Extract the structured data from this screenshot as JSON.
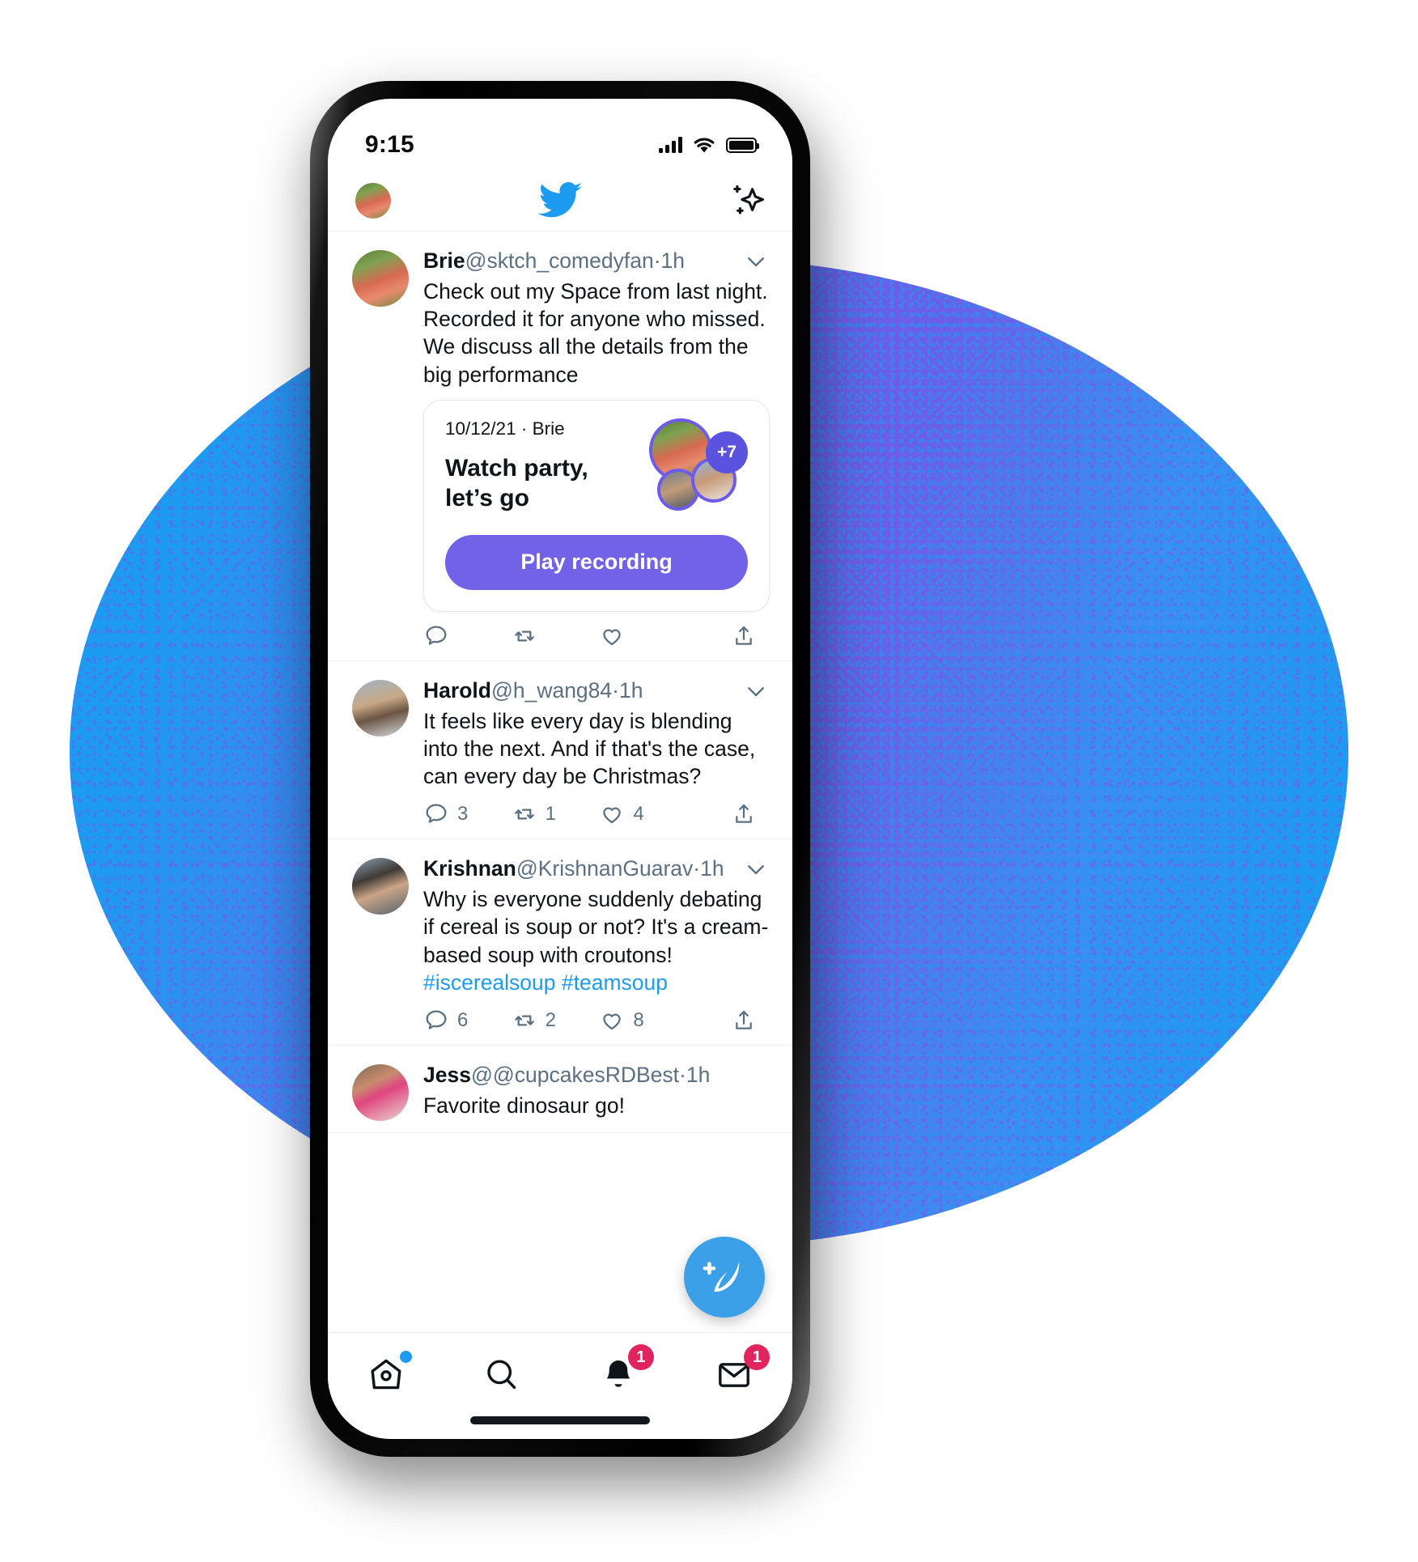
{
  "status_bar": {
    "time": "9:15",
    "icons": [
      "signal-bars-icon",
      "wifi-icon",
      "battery-icon"
    ]
  },
  "app_header": {
    "avatar_name": "brie-avatar",
    "logo": "twitter-bird-logo",
    "sparkle_label": "sparkle-icon"
  },
  "colors": {
    "twitter_blue": "#1d9bf0",
    "spaces_purple": "#7162e8",
    "badge_pink": "#e0245e",
    "text_primary": "#0f1419",
    "text_secondary": "#5b7083"
  },
  "tweets": [
    {
      "name": "Brie",
      "handle": "@sktch_comedyfan",
      "separator": "·",
      "time": "1h",
      "text": "Check out my Space from last night. Recorded it for anyone who missed. We discuss all the details from the big performance",
      "card": {
        "meta": "10/12/21 · Brie",
        "title_line1": "Watch party,",
        "title_line2": "let’s go",
        "extra_count": "+7",
        "button_label": "Play recording"
      },
      "actions": {
        "reply": "",
        "retweet": "",
        "like": "",
        "share": ""
      }
    },
    {
      "name": "Harold",
      "handle": "@h_wang84",
      "separator": "·",
      "time": "1h",
      "text": "It feels like every day is blending into the next. And if that's the case, can every day be Christmas?",
      "actions": {
        "reply": "3",
        "retweet": "1",
        "like": "4",
        "share": ""
      }
    },
    {
      "name": "Krishnan",
      "handle": "@KrishnanGuarav",
      "separator": "·",
      "time": "1h",
      "text_plain": "Why is everyone suddenly debating if cereal is soup or not? It's a cream-based soup with croutons! ",
      "hashtag1": "#iscerealsoup",
      "hashtag2": "#teamsoup",
      "actions": {
        "reply": "6",
        "retweet": "2",
        "like": "8",
        "share": ""
      }
    },
    {
      "name": "Jess",
      "handle": "@@cupcakesRDBest",
      "separator": "·",
      "time": "1h",
      "text": "Favorite dinosaur go!"
    }
  ],
  "compose": {
    "label": "compose-tweet-button"
  },
  "tab_bar": {
    "tabs": [
      {
        "name": "home-tab",
        "icon": "home-icon",
        "badge": "",
        "dot": true
      },
      {
        "name": "search-tab",
        "icon": "search-icon",
        "badge": "",
        "dot": false
      },
      {
        "name": "notifications-tab",
        "icon": "bell-icon",
        "badge": "1",
        "dot": false
      },
      {
        "name": "messages-tab",
        "icon": "mail-icon",
        "badge": "1",
        "dot": false
      }
    ]
  }
}
